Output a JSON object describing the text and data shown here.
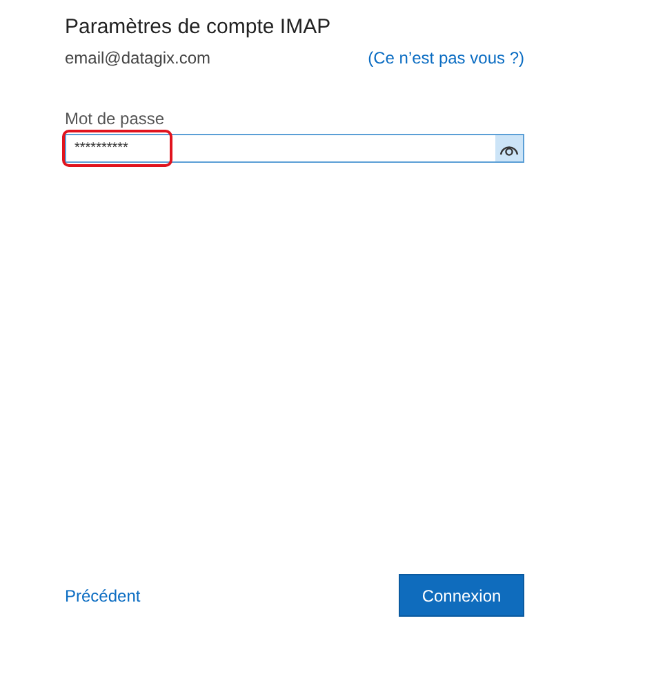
{
  "title": "Paramètres de compte IMAP",
  "account": {
    "email": "email@datagix.com",
    "switch_link": "(Ce n’est pas vous ?)"
  },
  "password": {
    "label": "Mot de passe",
    "value": "**********",
    "highlighted": true
  },
  "back_link": "Précédent",
  "primary_button": "Connexion"
}
